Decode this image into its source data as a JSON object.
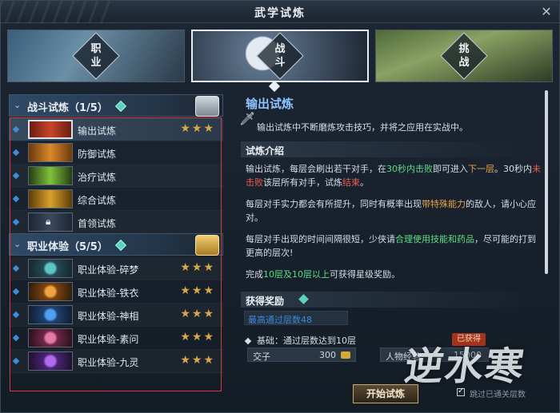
{
  "window": {
    "title": "武学试炼"
  },
  "modes": [
    {
      "label": "职业",
      "selected": false
    },
    {
      "label": "战斗",
      "selected": true
    },
    {
      "label": "挑战",
      "selected": false
    }
  ],
  "groups": [
    {
      "title": "战斗试炼（1/5）",
      "items": [
        {
          "label": "输出试炼",
          "stars": "★★★",
          "icon": "thumb-red",
          "selected": true
        },
        {
          "label": "防御试炼",
          "stars": "",
          "icon": "thumb-orange",
          "selected": false
        },
        {
          "label": "治疗试炼",
          "stars": "",
          "icon": "thumb-green",
          "selected": false
        },
        {
          "label": "综合试炼",
          "stars": "",
          "icon": "thumb-gold",
          "selected": false
        },
        {
          "label": "首领试炼",
          "stars": "",
          "icon": "lock-icon",
          "selected": false
        }
      ]
    },
    {
      "title": "职业体验（5/5）",
      "items": [
        {
          "label": "职业体验-碎梦",
          "stars": "★★★",
          "icon": "thumb-teal"
        },
        {
          "label": "职业体验-铁衣",
          "stars": "★★★",
          "icon": "thumb-amber"
        },
        {
          "label": "职业体验-神相",
          "stars": "★★★",
          "icon": "thumb-blue"
        },
        {
          "label": "职业体验-素问",
          "stars": "★★★",
          "icon": "thumb-pink"
        },
        {
          "label": "职业体验-九灵",
          "stars": "★★★",
          "icon": "thumb-purple"
        }
      ]
    }
  ],
  "detail": {
    "title": "输出试炼",
    "desc": "输出试炼中不断磨炼攻击技巧，并将之应用在实战中。",
    "intro_header": "试炼介绍",
    "p1_a": "输出试炼，每层会刷出若干对手，在",
    "p1_b": "30秒内击败",
    "p1_c": "即可进入",
    "p1_d": "下一层",
    "p1_e": "。30秒内",
    "p1_f": "未击败",
    "p1_g": "该层所有对手，试炼",
    "p1_h": "结束",
    "p1_i": "。",
    "p2_a": "每层对手实力都会有所提升，同时有概率出现",
    "p2_b": "带特殊能力",
    "p2_c": "的敌人，请小心应对。",
    "p3_a": "每层对手出现的时间间隔很短，少侠请",
    "p3_b": "合理使用技能和药品",
    "p3_c": "，尽可能的打到更高的层次!",
    "p4_a": "完成",
    "p4_b": "10层及10层以上",
    "p4_c": "可获得星级奖励。",
    "reward_header": "获得奖励",
    "best_floor": "最高通过层数48",
    "basic": "基础：通过层数达到10层",
    "claimed": "已获得",
    "rewards": [
      {
        "name": "交子",
        "qty": "300"
      },
      {
        "name": "人物经验",
        "qty": "15000"
      }
    ],
    "start_button": "开始试炼",
    "checkbox_label": "跳过已通关层数"
  },
  "watermark": "逆水寒",
  "colors": {
    "accent_blue": "#8fc3ff",
    "highlight_green": "#5fdc86",
    "highlight_orange": "#e6a34a",
    "highlight_red": "#ee5c4e",
    "star_gold": "#d6a84a"
  }
}
